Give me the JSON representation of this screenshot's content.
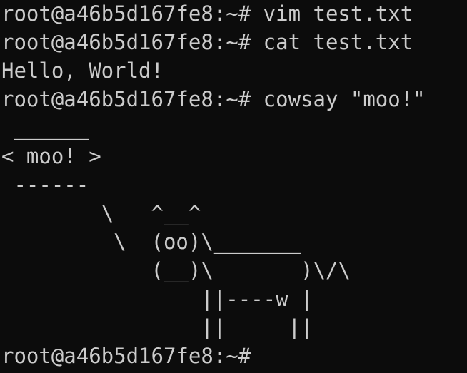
{
  "terminal": {
    "colors": {
      "background": "#0c0c0c",
      "foreground": "#cccccc"
    },
    "lines": [
      "root@a46b5d167fe8:~# vim test.txt",
      "root@a46b5d167fe8:~# cat test.txt",
      "Hello, World!",
      "root@a46b5d167fe8:~# cowsay \"moo!\"",
      " ______",
      "< moo! >",
      " ------",
      "        \\   ^__^",
      "         \\  (oo)\\_______",
      "            (__)\\       )\\/\\",
      "                ||----w |",
      "                ||     ||",
      "root@a46b5d167fe8:~# "
    ]
  }
}
